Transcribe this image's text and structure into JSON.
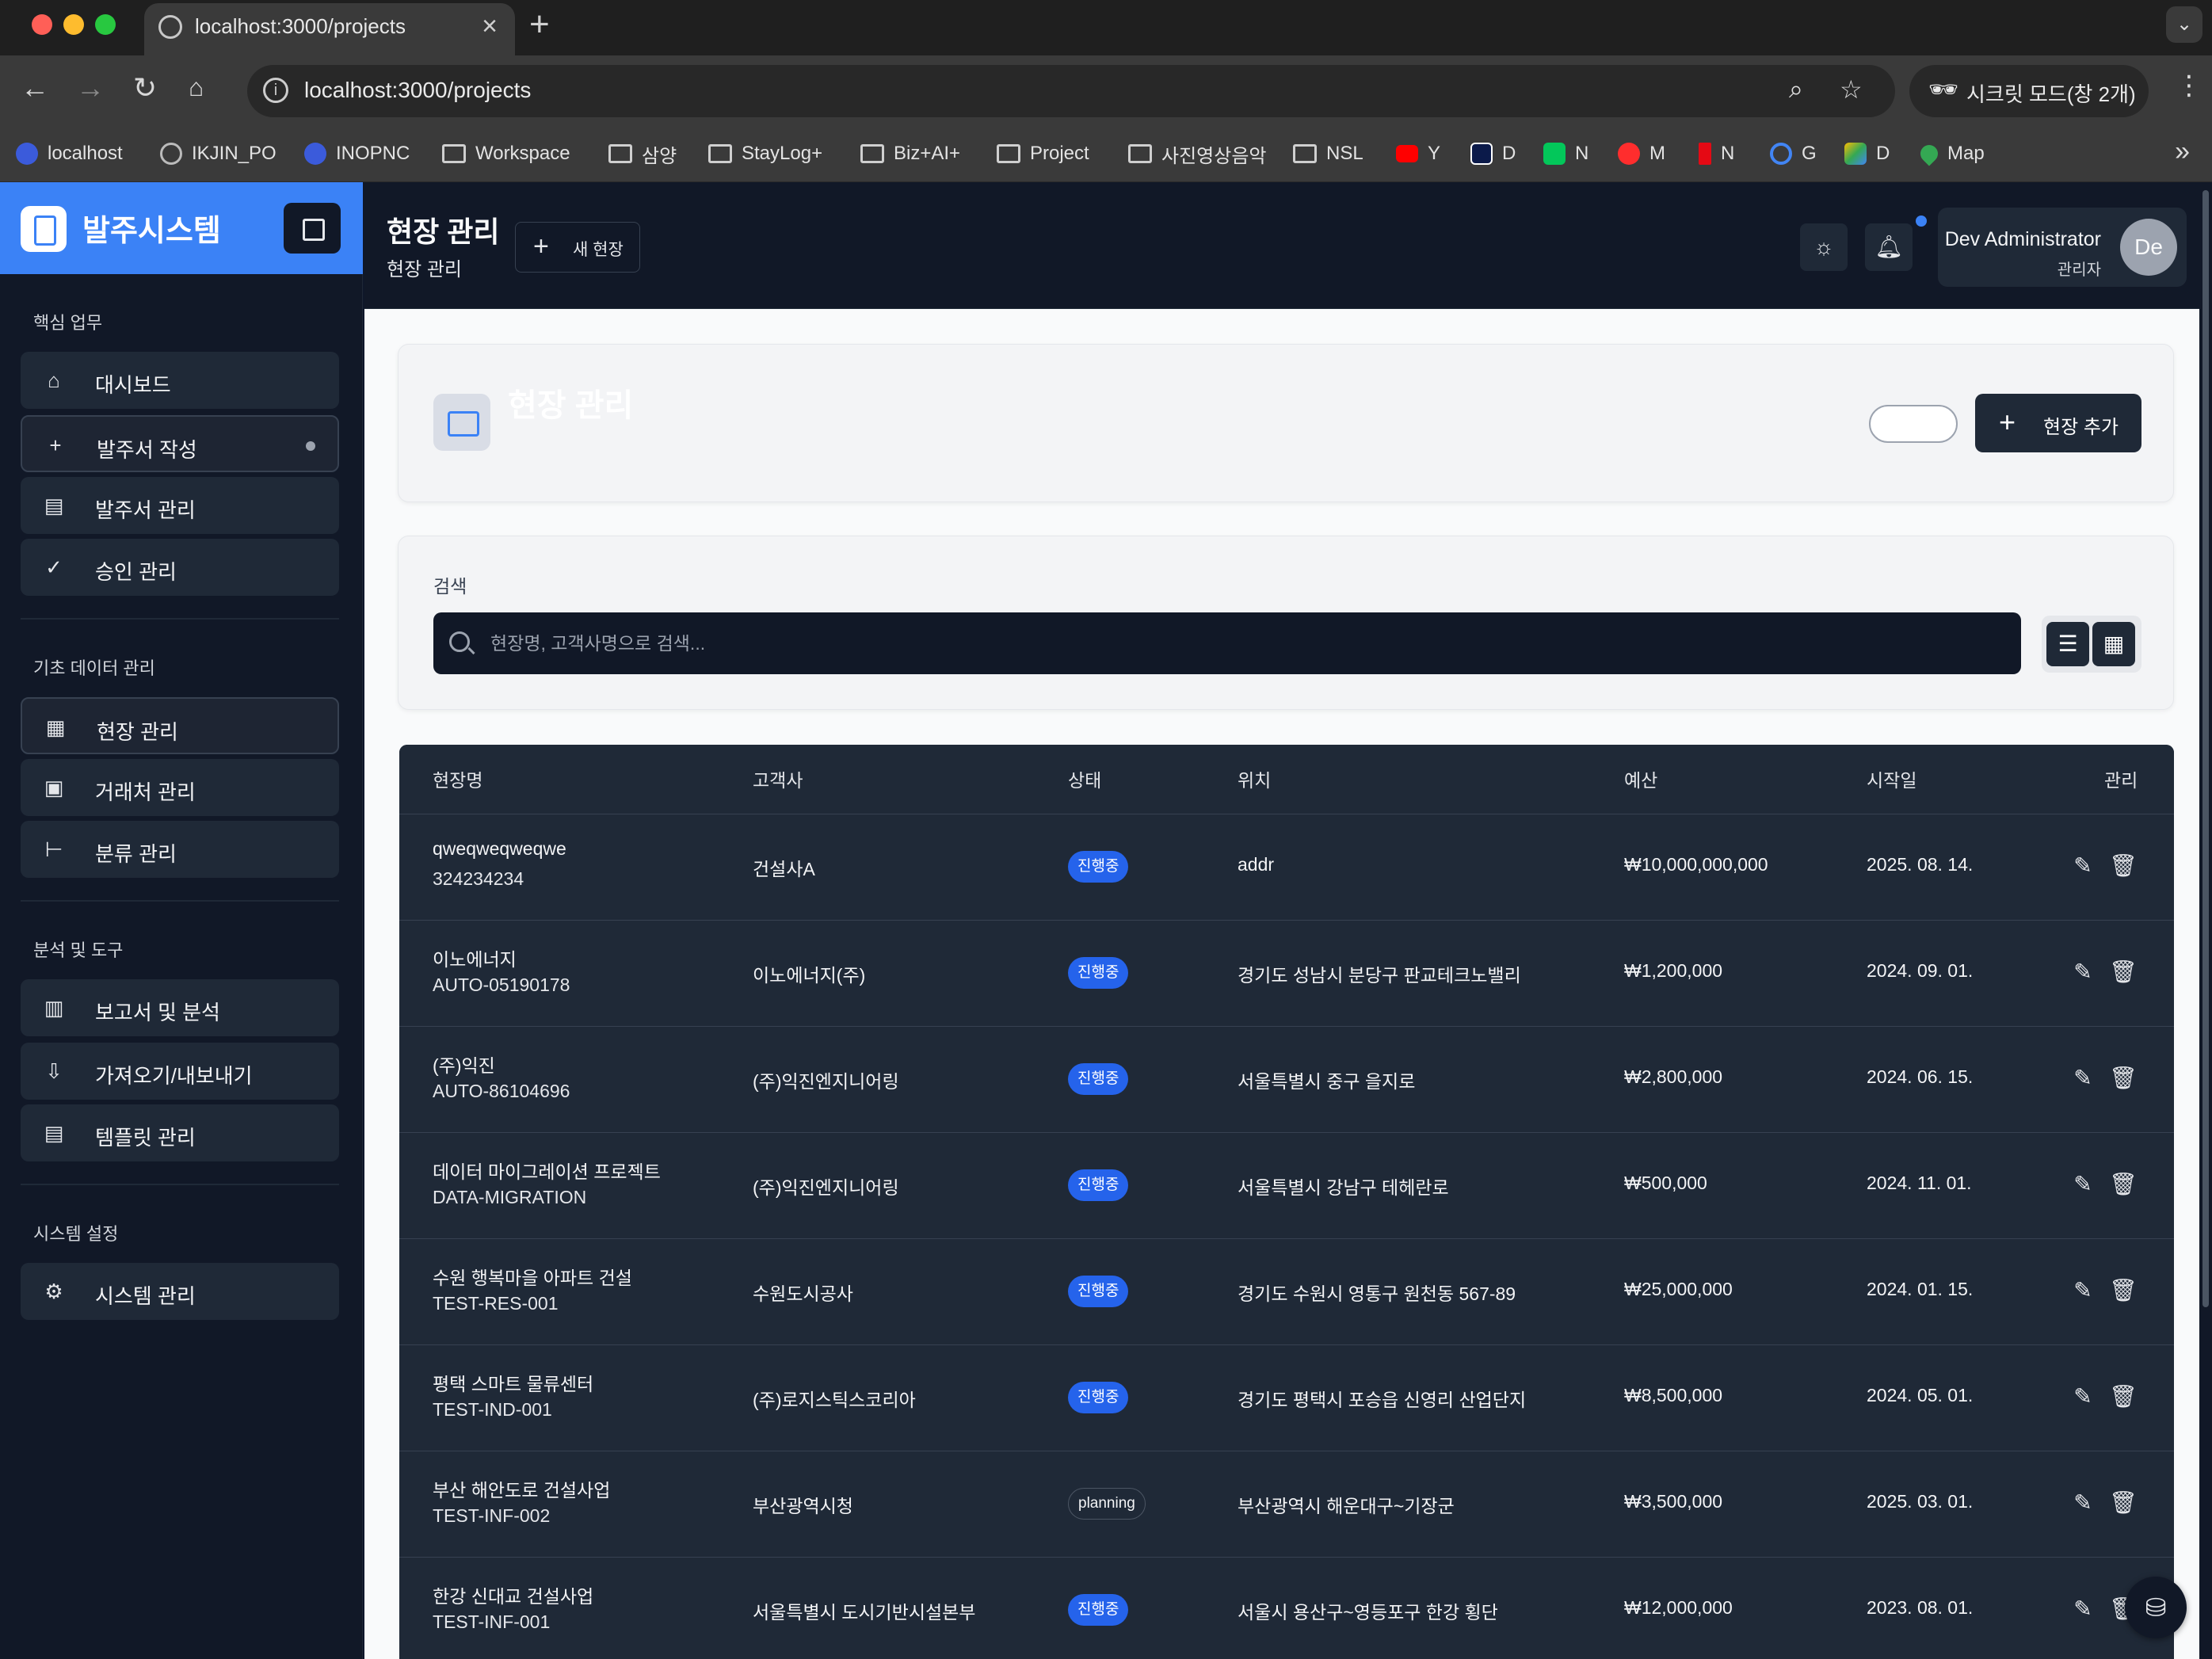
{
  "browser": {
    "tab_title": "localhost:3000/projects",
    "url": "localhost:3000/projects",
    "incognito_label": "시크릿 모드(창 2개)",
    "bookmarks": [
      {
        "label": "localhost",
        "icon": "app-icon",
        "color": "#3b5bdb"
      },
      {
        "label": "IKJIN_PO",
        "icon": "globe-icon",
        "color": "#bbbbbb"
      },
      {
        "label": "INOPNC",
        "icon": "app-icon",
        "color": "#3b5bdb"
      },
      {
        "label": "Workspace",
        "icon": "folder-icon"
      },
      {
        "label": "삼양",
        "icon": "folder-icon"
      },
      {
        "label": "StayLog+",
        "icon": "folder-icon"
      },
      {
        "label": "Biz+AI+",
        "icon": "folder-icon"
      },
      {
        "label": "Project",
        "icon": "folder-icon"
      },
      {
        "label": "사진영상음악",
        "icon": "folder-icon"
      },
      {
        "label": "NSL",
        "icon": "folder-icon"
      },
      {
        "label": "Y",
        "icon": "youtube-icon",
        "color": "#ff0000"
      },
      {
        "label": "D",
        "icon": "d-icon",
        "color": "#0b1a4a"
      },
      {
        "label": "N",
        "icon": "naver-icon",
        "color": "#03c75a"
      },
      {
        "label": "M",
        "icon": "music-icon",
        "color": "#ff2d2d"
      },
      {
        "label": "N",
        "icon": "netflix-icon",
        "color": "#e50914"
      },
      {
        "label": "G",
        "icon": "google-icon",
        "color": "#4285f4"
      },
      {
        "label": "D",
        "icon": "drive-icon",
        "color": "#fbbc04"
      },
      {
        "label": "Map",
        "icon": "map-icon",
        "color": "#34a853"
      }
    ]
  },
  "sidebar": {
    "brand": "발주시스템",
    "sections": [
      {
        "title": "핵심 업무",
        "items": [
          {
            "label": "대시보드",
            "icon": "home-icon"
          },
          {
            "label": "발주서 작성",
            "icon": "plus-icon"
          },
          {
            "label": "발주서 관리",
            "icon": "document-icon"
          },
          {
            "label": "승인 관리",
            "icon": "check-circle-icon"
          }
        ]
      },
      {
        "title": "기초 데이터 관리",
        "items": [
          {
            "label": "현장 관리",
            "icon": "building-icon"
          },
          {
            "label": "거래처 관리",
            "icon": "office-icon"
          },
          {
            "label": "분류 관리",
            "icon": "tree-icon"
          }
        ]
      },
      {
        "title": "분석 및 도구",
        "items": [
          {
            "label": "보고서 및 분석",
            "icon": "bar-chart-icon"
          },
          {
            "label": "가져오기/내보내기",
            "icon": "file-import-icon"
          },
          {
            "label": "템플릿 관리",
            "icon": "template-icon"
          }
        ]
      },
      {
        "title": "시스템 설정",
        "items": [
          {
            "label": "시스템 관리",
            "icon": "gear-icon"
          }
        ]
      }
    ]
  },
  "header": {
    "title": "현장 관리",
    "subtitle": "현장 관리",
    "new_button": "새 현장",
    "user_name": "Dev Administrator",
    "user_role": "관리자",
    "avatar_initials": "De"
  },
  "page": {
    "title": "현장 관리",
    "add_button": "현장 추가",
    "search_label": "검색",
    "search_placeholder": "현장명, 고객사명으로 검색..."
  },
  "table": {
    "headers": [
      "현장명",
      "고객사",
      "상태",
      "위치",
      "예산",
      "시작일",
      "관리"
    ],
    "rows": [
      {
        "name": "qweqweqweqwe",
        "code": "324234234",
        "client": "건설사A",
        "status": "진행중",
        "status_style": "blue",
        "location": "addr",
        "budget": "₩10,000,000,000",
        "start": "2025. 08. 14."
      },
      {
        "name": "이노에너지",
        "code": "AUTO-05190178",
        "client": "이노에너지(주)",
        "status": "진행중",
        "status_style": "blue",
        "location": "경기도 성남시 분당구 판교테크노밸리",
        "budget": "₩1,200,000",
        "start": "2024. 09. 01."
      },
      {
        "name": "(주)익진",
        "code": "AUTO-86104696",
        "client": "(주)익진엔지니어링",
        "status": "진행중",
        "status_style": "blue",
        "location": "서울특별시 중구 을지로",
        "budget": "₩2,800,000",
        "start": "2024. 06. 15."
      },
      {
        "name": "데이터 마이그레이션 프로젝트",
        "code": "DATA-MIGRATION",
        "client": "(주)익진엔지니어링",
        "status": "진행중",
        "status_style": "blue",
        "location": "서울특별시 강남구 테헤란로",
        "budget": "₩500,000",
        "start": "2024. 11. 01."
      },
      {
        "name": "수원 행복마을 아파트 건설",
        "code": "TEST-RES-001",
        "client": "수원도시공사",
        "status": "진행중",
        "status_style": "blue",
        "location": "경기도 수원시 영통구 원천동 567-89",
        "budget": "₩25,000,000",
        "start": "2024. 01. 15."
      },
      {
        "name": "평택 스마트 물류센터",
        "code": "TEST-IND-001",
        "client": "(주)로지스틱스코리아",
        "status": "진행중",
        "status_style": "blue",
        "location": "경기도 평택시 포승읍 신영리 산업단지",
        "budget": "₩8,500,000",
        "start": "2024. 05. 01."
      },
      {
        "name": "부산 해안도로 건설사업",
        "code": "TEST-INF-002",
        "client": "부산광역시청",
        "status": "planning",
        "status_style": "outline",
        "location": "부산광역시 해운대구~기장군",
        "budget": "₩3,500,000",
        "start": "2025. 03. 01."
      },
      {
        "name": "한강 신대교 건설사업",
        "code": "TEST-INF-001",
        "client": "서울특별시 도시기반시설본부",
        "status": "진행중",
        "status_style": "blue",
        "location": "서울시 용산구~영등포구 한강 횡단",
        "budget": "₩12,000,000",
        "start": "2023. 08. 01."
      }
    ]
  }
}
